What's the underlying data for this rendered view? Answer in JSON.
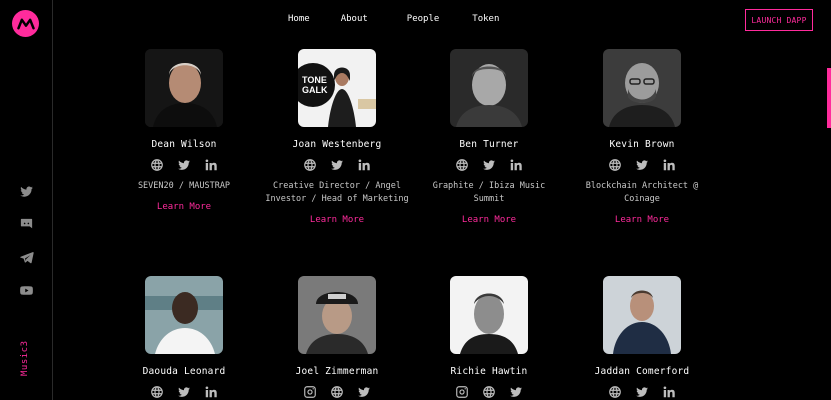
{
  "nav": {
    "items": [
      "Home",
      "About",
      "People",
      "Token"
    ],
    "launch_label": "LAUNCH DAPP"
  },
  "sidebar": {
    "brand": "Music3",
    "socials": [
      "twitter-icon",
      "discord-icon",
      "telegram-icon",
      "youtube-icon"
    ]
  },
  "colors": {
    "accent": "#ff2b9c",
    "background": "#000000"
  },
  "people": [
    {
      "name": "Dean Wilson",
      "role": "SEVEN20 / MAUSTRAP",
      "links": [
        "globe-icon",
        "twitter-icon",
        "linkedin-icon"
      ],
      "cta": "Learn More"
    },
    {
      "name": "Joan Westenberg",
      "role": "Creative Director / Angel Investor / Head of Marketing",
      "links": [
        "globe-icon",
        "twitter-icon",
        "linkedin-icon"
      ],
      "cta": "Learn More"
    },
    {
      "name": "Ben Turner",
      "role": "Graphite / Ibiza Music Summit",
      "links": [
        "globe-icon",
        "twitter-icon",
        "linkedin-icon"
      ],
      "cta": "Learn More"
    },
    {
      "name": "Kevin Brown",
      "role": "Blockchain Architect @ Coinage",
      "links": [
        "globe-icon",
        "twitter-icon",
        "linkedin-icon"
      ],
      "cta": "Learn More"
    },
    {
      "name": "Daouda Leonard",
      "role": "",
      "links": [
        "globe-icon",
        "twitter-icon",
        "linkedin-icon"
      ],
      "cta": ""
    },
    {
      "name": "Joel Zimmerman",
      "role": "",
      "links": [
        "instagram-icon",
        "globe-icon",
        "twitter-icon"
      ],
      "cta": ""
    },
    {
      "name": "Richie Hawtin",
      "role": "",
      "links": [
        "instagram-icon",
        "globe-icon",
        "twitter-icon"
      ],
      "cta": ""
    },
    {
      "name": "Jaddan Comerford",
      "role": "",
      "links": [
        "globe-icon",
        "twitter-icon",
        "linkedin-icon"
      ],
      "cta": ""
    }
  ]
}
